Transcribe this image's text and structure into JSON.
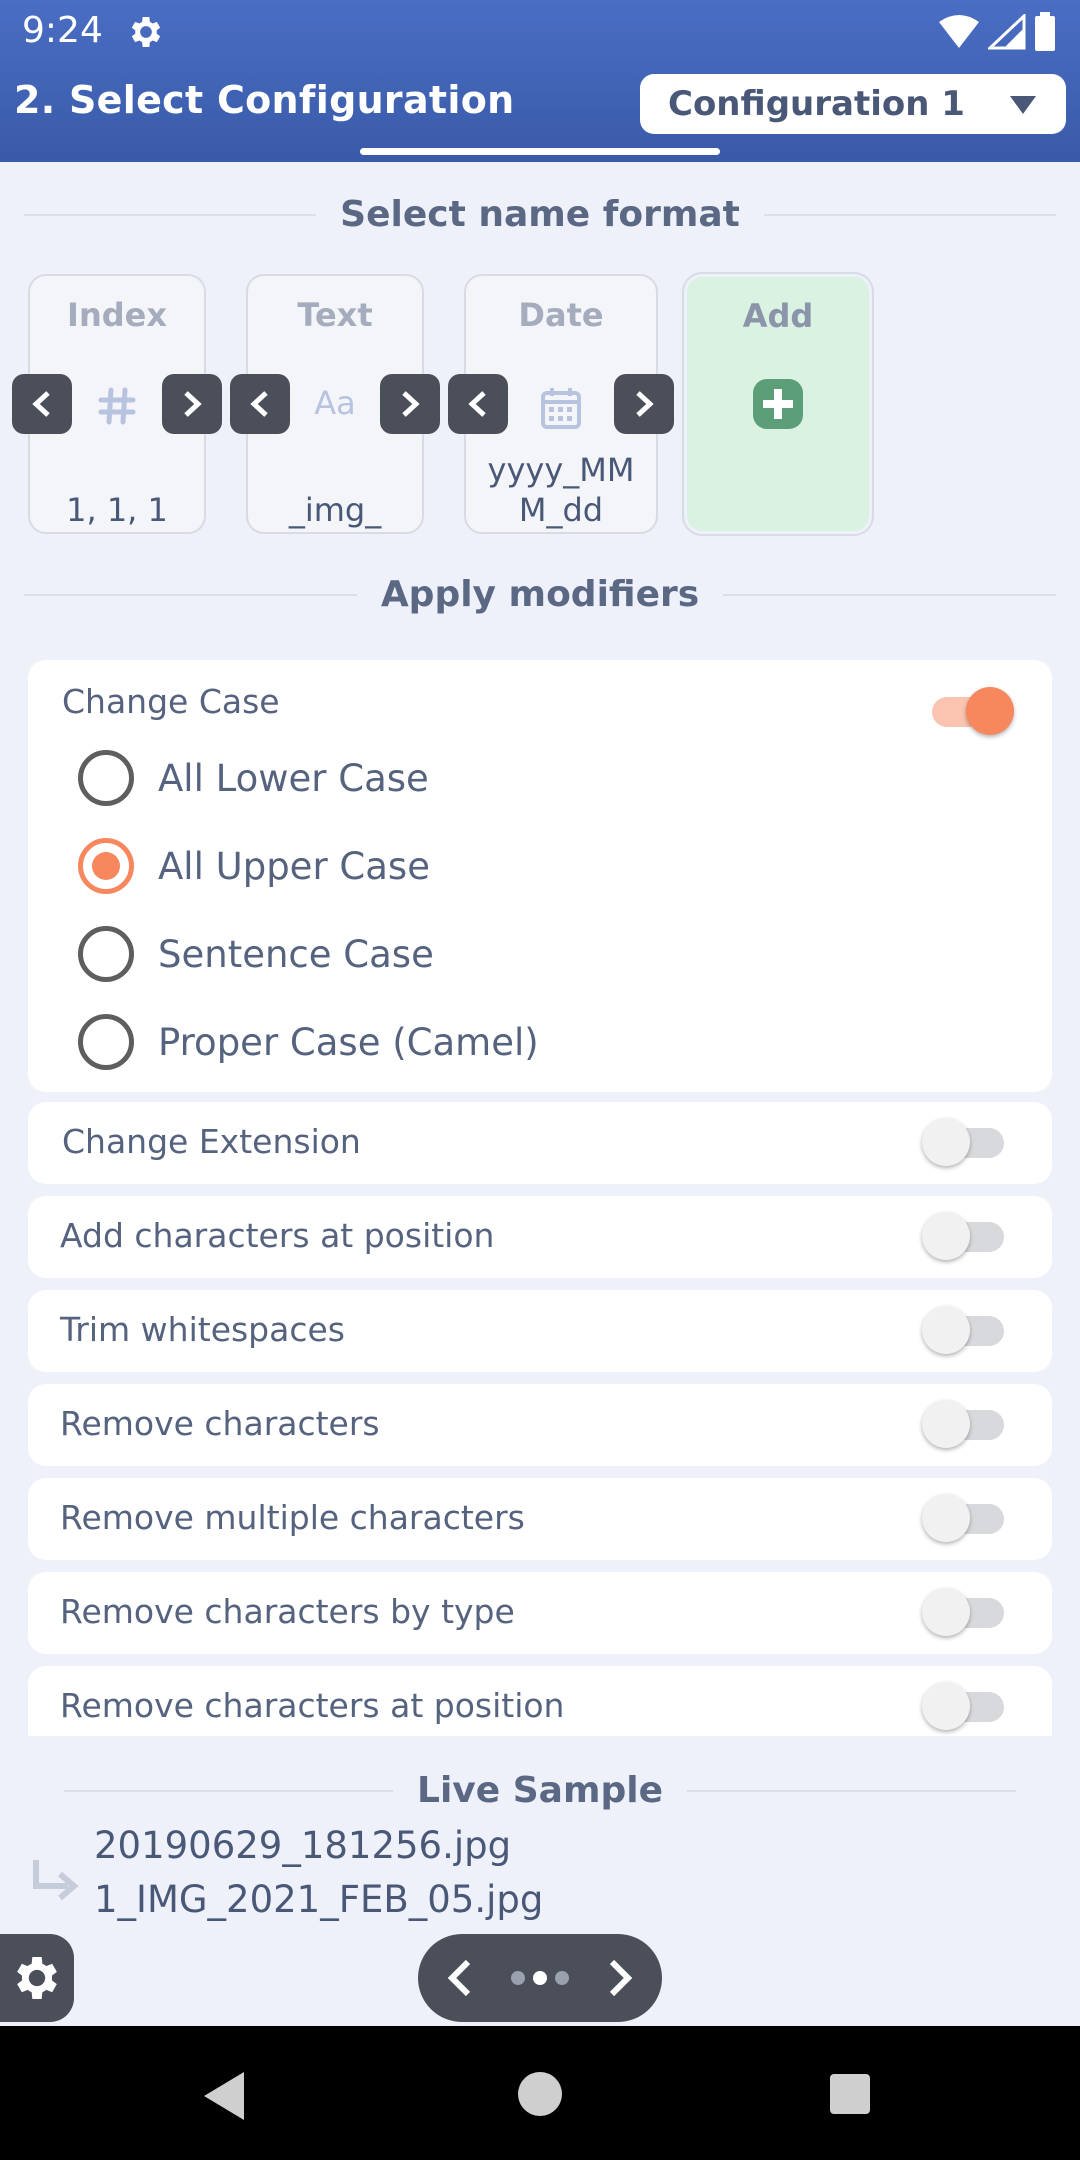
{
  "status_bar": {
    "time": "9:24"
  },
  "header": {
    "title": "2. Select Configuration",
    "config_selected": "Configuration 1"
  },
  "name_format": {
    "heading": "Select name format",
    "cards": [
      {
        "title": "Index",
        "icon": "hash-icon",
        "value": "1, 1, 1"
      },
      {
        "title": "Text",
        "icon": "text-format-icon",
        "icon_text": "Aa",
        "value": "_img_"
      },
      {
        "title": "Date",
        "icon": "calendar-icon",
        "value_line1": "yyyy_MM",
        "value_line2": "M_dd"
      },
      {
        "title": "Add",
        "icon": "add-icon"
      }
    ]
  },
  "modifiers": {
    "heading": "Apply modifiers",
    "change_case": {
      "label": "Change Case",
      "enabled": true,
      "options": [
        {
          "label": "All Lower Case",
          "checked": false
        },
        {
          "label": "All Upper Case",
          "checked": true
        },
        {
          "label": "Sentence Case",
          "checked": false
        },
        {
          "label": "Proper Case (Camel)",
          "checked": false
        }
      ]
    },
    "rows": [
      {
        "label": "Change Extension",
        "enabled": false
      },
      {
        "label": "Add characters at position",
        "enabled": false
      },
      {
        "label": "Trim whitespaces",
        "enabled": false
      },
      {
        "label": "Remove characters",
        "enabled": false
      },
      {
        "label": "Remove multiple characters",
        "enabled": false
      },
      {
        "label": "Remove characters by type",
        "enabled": false
      },
      {
        "label": "Remove characters at position",
        "enabled": false
      }
    ]
  },
  "live_sample": {
    "heading": "Live Sample",
    "original": "20190629_181256.jpg",
    "renamed": "1_IMG_2021_FEB_05.jpg"
  },
  "colors": {
    "header": "#3a5aa8",
    "accent": "#f7875c",
    "add_card": "#d9f2e2"
  }
}
